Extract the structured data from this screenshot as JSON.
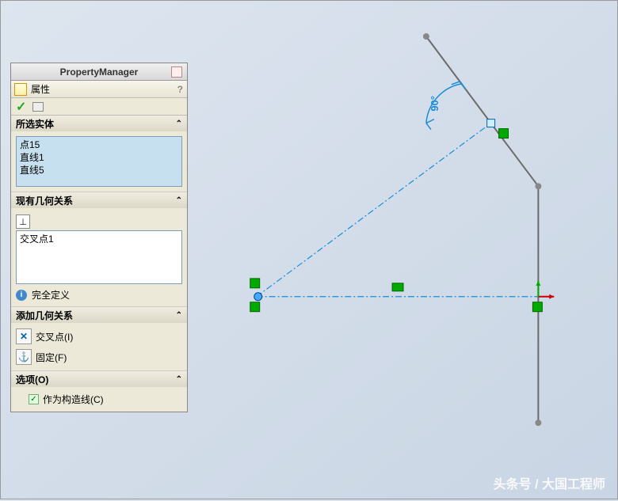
{
  "header": {
    "title": "PropertyManager",
    "prop_label": "属性"
  },
  "sections": {
    "selected": {
      "title": "所选实体",
      "items": [
        "点15",
        "直线1",
        "直线5"
      ]
    },
    "existing": {
      "title": "现有几何关系",
      "items": [
        "交叉点1"
      ],
      "status": "完全定义"
    },
    "add": {
      "title": "添加几何关系",
      "intersection": "交叉点(I)",
      "fix": "固定(F)"
    },
    "options": {
      "title": "选项(O)",
      "construction": "作为构造线(C)"
    }
  },
  "canvas": {
    "angle": "90°",
    "watermark": "头条号 / 大国工程师"
  }
}
